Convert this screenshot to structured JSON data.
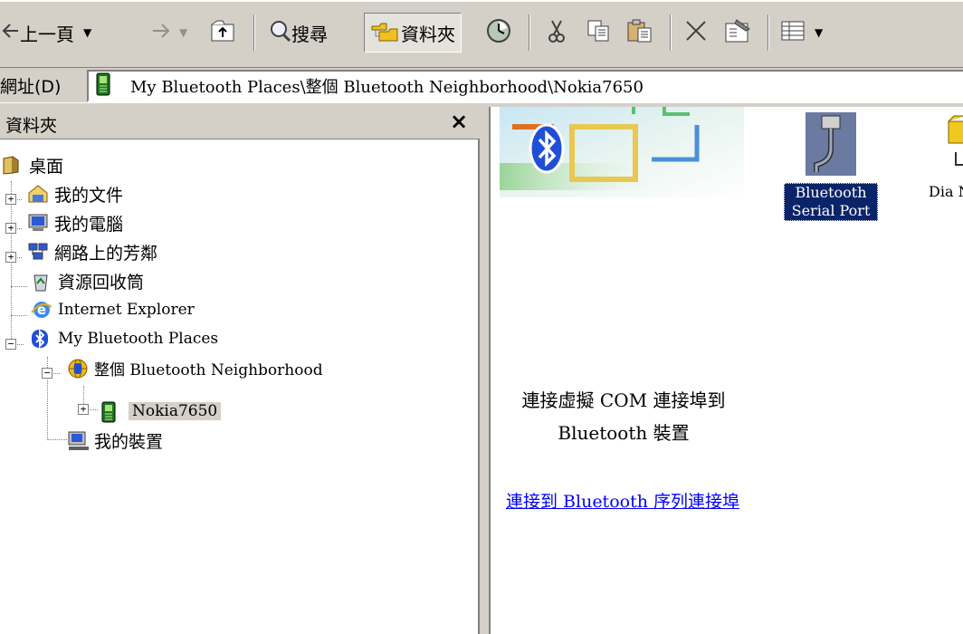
{
  "toolbar": {
    "back_label": "上一頁",
    "search_label": "搜尋",
    "folders_label": "資料夾"
  },
  "address": {
    "label": "網址(D)",
    "value": "My Bluetooth Places\\整個 Bluetooth Neighborhood\\Nokia7650"
  },
  "folders_pane": {
    "title": "資料夾",
    "close_glyph": "×",
    "tree": [
      {
        "label": "桌面"
      },
      {
        "label": "我的文件"
      },
      {
        "label": "我的電腦"
      },
      {
        "label": "網路上的芳鄰"
      },
      {
        "label": "資源回收筒"
      },
      {
        "label": "Internet Explorer"
      },
      {
        "label": "My Bluetooth Places"
      },
      {
        "label": "整個 Bluetooth Neighborhood"
      },
      {
        "label": "Nokia7650"
      },
      {
        "label": "我的裝置"
      }
    ]
  },
  "content": {
    "description": "連接虛擬 COM 連接埠到 Bluetooth 裝置",
    "link": "連接到 Bluetooth 序列連接埠",
    "items": [
      {
        "label": "Bluetooth Serial Port"
      },
      {
        "label": "Dia Netw"
      }
    ]
  },
  "colors": {
    "window_bg": "#d4d0c8",
    "link": "#0000ff",
    "selection": "#0a246a",
    "bluetooth": "#1f4fd6"
  }
}
